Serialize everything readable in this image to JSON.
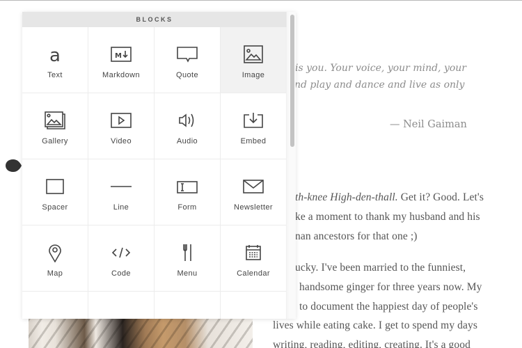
{
  "blocks_panel": {
    "title": "BLOCKS",
    "items": [
      {
        "label": "Text",
        "icon": "text-icon",
        "active": false
      },
      {
        "label": "Markdown",
        "icon": "markdown-icon",
        "active": false
      },
      {
        "label": "Quote",
        "icon": "quote-icon",
        "active": false
      },
      {
        "label": "Image",
        "icon": "image-icon",
        "active": true
      },
      {
        "label": "Gallery",
        "icon": "gallery-icon",
        "active": false
      },
      {
        "label": "Video",
        "icon": "video-icon",
        "active": false
      },
      {
        "label": "Audio",
        "icon": "audio-icon",
        "active": false
      },
      {
        "label": "Embed",
        "icon": "embed-icon",
        "active": false
      },
      {
        "label": "Spacer",
        "icon": "spacer-icon",
        "active": false
      },
      {
        "label": "Line",
        "icon": "line-icon",
        "active": false
      },
      {
        "label": "Form",
        "icon": "form-icon",
        "active": false
      },
      {
        "label": "Newsletter",
        "icon": "newsletter-icon",
        "active": false
      },
      {
        "label": "Map",
        "icon": "map-pin-icon",
        "active": false
      },
      {
        "label": "Code",
        "icon": "code-icon",
        "active": false
      },
      {
        "label": "Menu",
        "icon": "fork-knife-icon",
        "active": false
      },
      {
        "label": "Calendar",
        "icon": "calendar-icon",
        "active": false
      }
    ]
  },
  "page": {
    "quote_lines": [
      "is you. Your voice, your mind, your",
      "nd play and dance and live as only"
    ],
    "quote_attribution": "— Neil Gaiman",
    "body_lines": [
      {
        "italic": "th-knee High-den-thall.",
        "rest": " Get it? Good. Let's"
      },
      {
        "italic": "",
        "rest": "ke a moment to thank my husband and his"
      },
      {
        "italic": "",
        "rest": "nan ancestors for that one ;)"
      },
      {
        "italic": "",
        "rest": "ucky. I've been married to the funniest,"
      },
      {
        "italic": "",
        "rest": "handsome ginger for three years now. My"
      },
      {
        "italic": "",
        "rest": "to document the happiest day of people's"
      },
      {
        "italic": "",
        "rest": "lives while eating cake. I get to spend my days"
      },
      {
        "italic": "",
        "rest": "writing, reading, editing, creating. It's a good"
      }
    ]
  }
}
